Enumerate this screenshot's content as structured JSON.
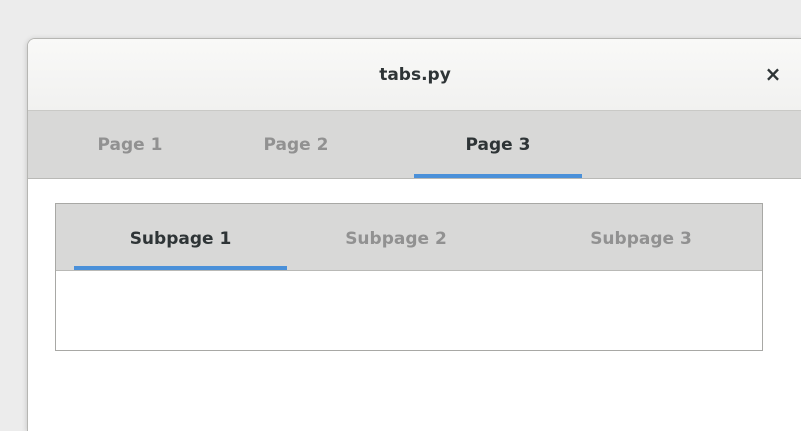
{
  "window": {
    "title": "tabs.py",
    "close_glyph": "×"
  },
  "tabs": [
    {
      "label": "Page 1",
      "active": false
    },
    {
      "label": "Page 2",
      "active": false
    },
    {
      "label": "Page 3",
      "active": true
    }
  ],
  "subtabs": [
    {
      "label": "Subpage 1",
      "active": true
    },
    {
      "label": "Subpage 2",
      "active": false
    },
    {
      "label": "Subpage 3",
      "active": false
    }
  ],
  "colors": {
    "accent": "#4a90d9",
    "tab_inactive_text": "#919191",
    "tab_active_text": "#2e3436",
    "tabbar_bg": "#d8d8d7"
  }
}
